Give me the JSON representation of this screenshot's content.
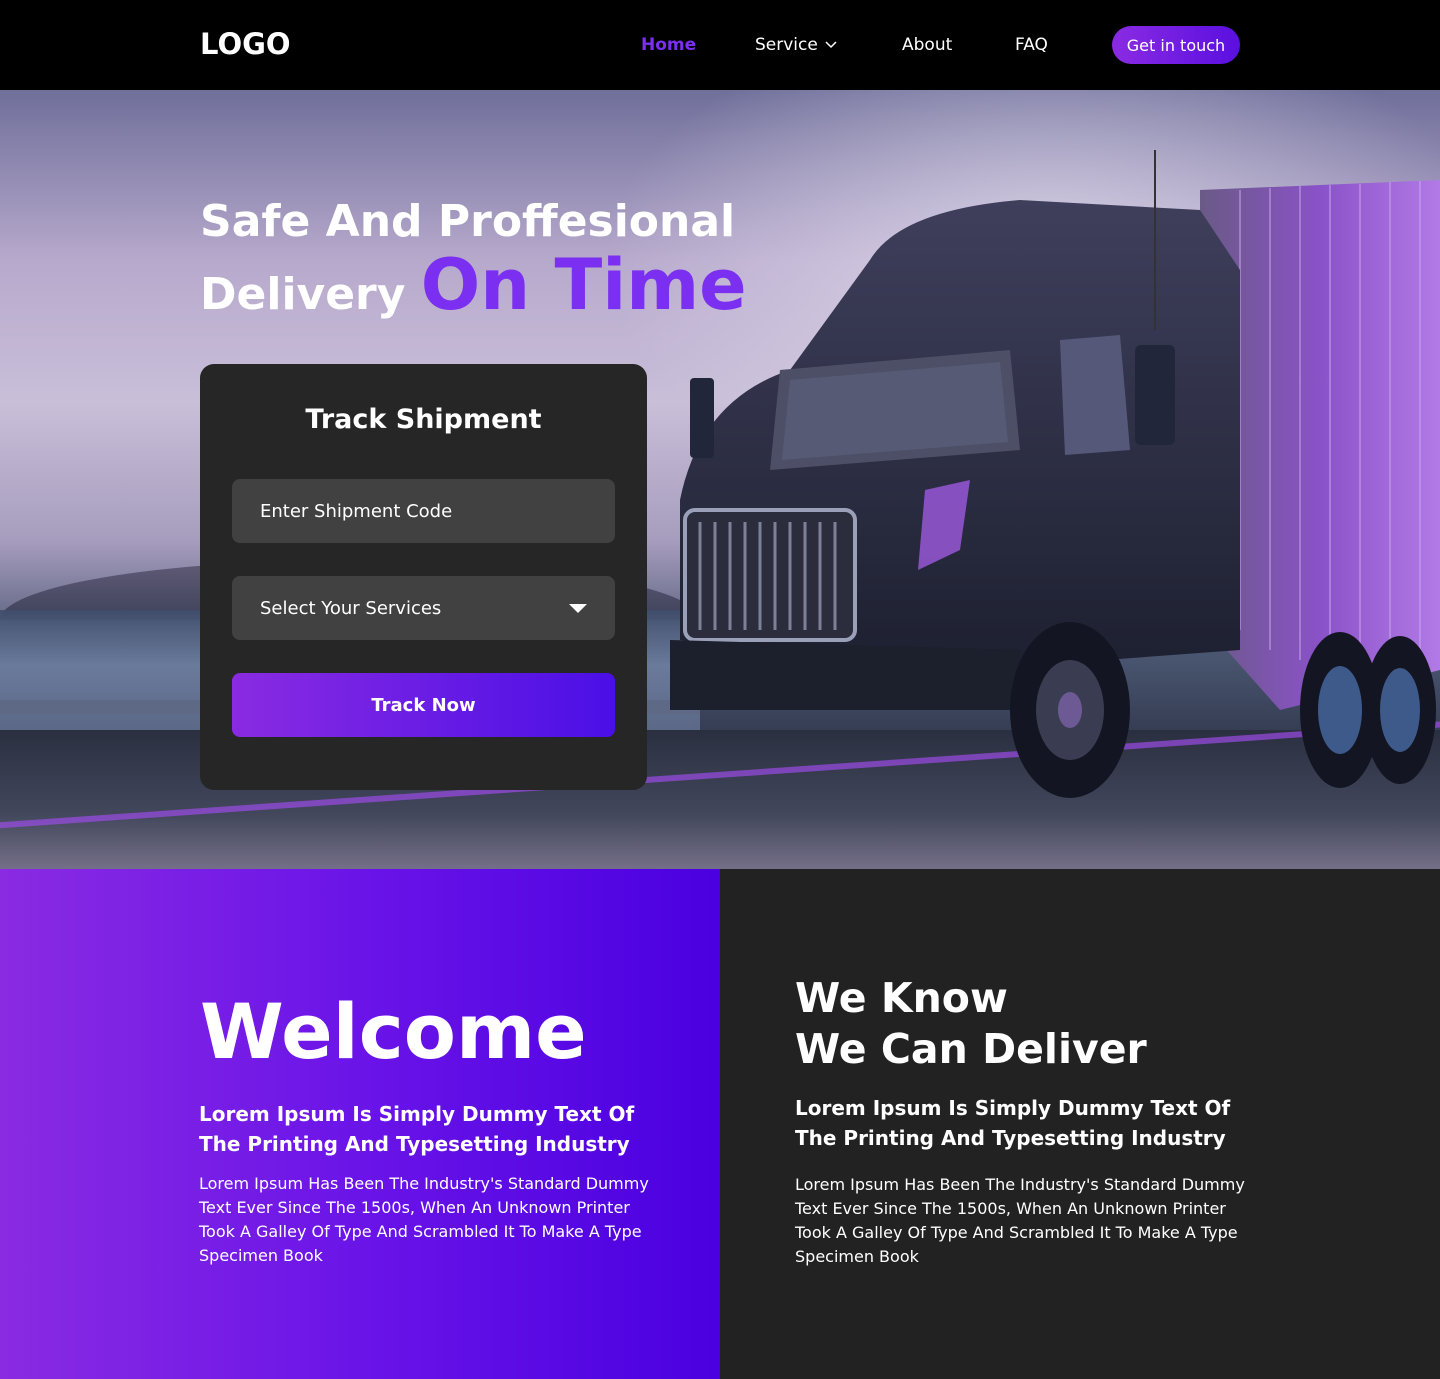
{
  "nav": {
    "logo": "LOGO",
    "links": [
      "Home",
      "Service",
      "About",
      "FAQ"
    ],
    "cta": "Get in touch"
  },
  "hero": {
    "title_line1": "Safe And Proffesional",
    "title_line2_prefix": "Delivery",
    "title_accent": "On Time"
  },
  "track": {
    "title": "Track Shipment",
    "code_placeholder": "Enter Shipment Code",
    "service_select": "Select Your Services",
    "button": "Track Now"
  },
  "welcome": {
    "title": "Welcome",
    "subtitle": "Lorem Ipsum Is Simply Dummy Text Of The Printing And Typesetting Industry",
    "body": "Lorem Ipsum Has Been The Industry's Standard Dummy Text Ever Since The 1500s, When An Unknown Printer Took A Galley Of Type And Scrambled It To Make A Type Specimen Book"
  },
  "deliver": {
    "title_line1": "We Know",
    "title_line2": "We Can Deliver",
    "subtitle": "Lorem Ipsum Is Simply Dummy Text Of The Printing And Typesetting Industry",
    "body": "Lorem Ipsum Has Been The Industry's Standard Dummy Text Ever Since The 1500s, When An Unknown Printer Took A Galley Of Type And Scrambled It To Make A Type Specimen Book"
  },
  "colors": {
    "accent": "#7b2ff0",
    "gradient_start": "#8a2be2",
    "gradient_end": "#4a00e0",
    "card": "#262626",
    "dark_section": "#222222"
  },
  "icons": {
    "service_dropdown": "chevron-down-icon",
    "select_caret": "caret-down-icon"
  }
}
